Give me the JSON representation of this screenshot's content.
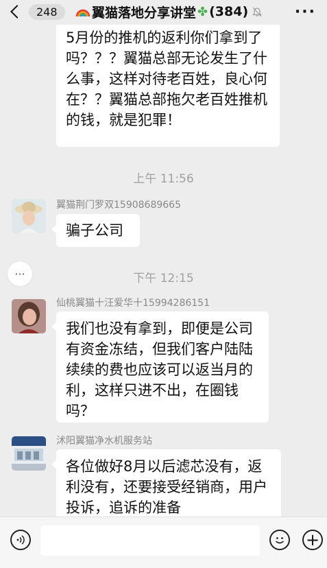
{
  "header": {
    "back_count": "248",
    "title": "翼猫落地分享讲堂",
    "member_count": "(384)",
    "more": "···"
  },
  "messages": [
    {
      "text": "5月份的推机的返利你们拿到了吗？？？翼猫总部无论发生了什么事，这样对待老百姓，良心何在？？翼猫总部拖欠老百姓推机的钱，就是犯罪！"
    },
    {
      "time": "上午 11:56"
    },
    {
      "sender": "翼猫荆门罗双15908689665",
      "text": "骗子公司"
    },
    {
      "time": "下午 12:15"
    },
    {
      "sender": "仙桃翼猫十汪爱华十15994286151",
      "text": "我们也没有拿到，即便是公司有资金冻结，但我们客户陆陆续续的费也应该可以返当月的利，这样只进不出，在圈钱吗？"
    },
    {
      "sender": "沭阳翼猫净水机服务站",
      "text": "各位做好8月以后滤芯没有，返利没有，还要接受经销商，用户投诉，追诉的准备"
    }
  ],
  "floating_menu": "···",
  "input_bar": {
    "plus": "+"
  },
  "colors": {
    "background": "#ededed",
    "bubble": "#ffffff",
    "time_text": "#a0a0a0",
    "sender_text": "#888888"
  },
  "icons": [
    "back-chevron-icon",
    "rainbow-icon",
    "clover-icon",
    "mute-bell-icon",
    "more-icon",
    "voice-icon",
    "emoji-icon",
    "plus-icon"
  ]
}
